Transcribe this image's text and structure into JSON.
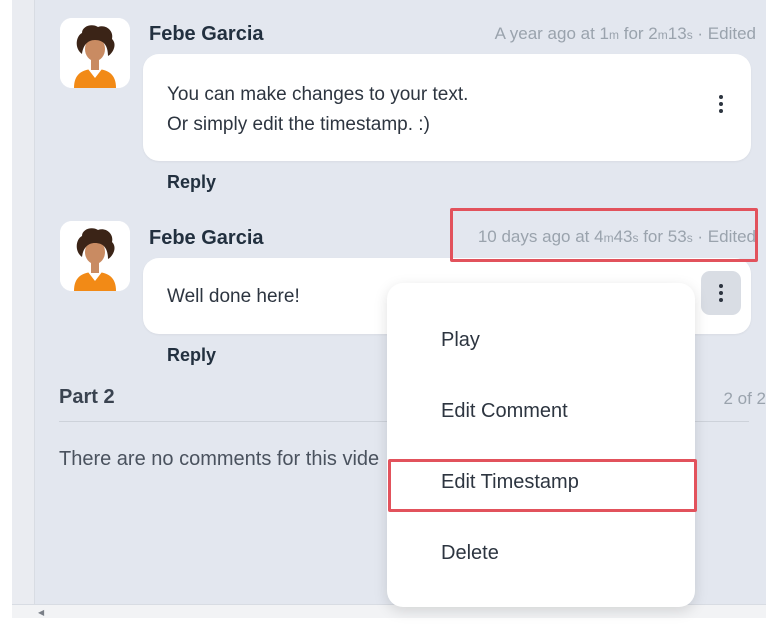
{
  "comments": [
    {
      "author": "Febe Garcia",
      "meta": {
        "prefix": "A year ago at 1",
        "u1": "m",
        "mid": " for 2",
        "u2": "m",
        "mid2": "13",
        "u3": "s",
        "suffix": " · Edited"
      },
      "lines": [
        "You can make changes to your text.",
        "Or simply edit the timestamp. :)"
      ],
      "reply_label": "Reply"
    },
    {
      "author": "Febe Garcia",
      "meta": {
        "prefix": "10 days ago at 4",
        "u1": "m",
        "mid": "43",
        "u2": "s",
        "mid2": " for 53",
        "u3": "s",
        "suffix": " · Edited"
      },
      "lines": [
        "Well done here!"
      ],
      "reply_label": "Reply"
    }
  ],
  "part": {
    "title": "Part 2",
    "count": "2 of 2",
    "empty_text": "There are no comments for this vide"
  },
  "context_menu": {
    "items": [
      "Play",
      "Edit Comment",
      "Edit Timestamp",
      "Delete"
    ]
  },
  "colors": {
    "highlight": "#e2525c",
    "avatar_hair": "#3b2417",
    "avatar_skin": "#c98b62",
    "avatar_shirt": "#f28a16"
  },
  "icons": {
    "kebab": "more-vertical-icon",
    "scroll": "caret-left-icon"
  }
}
